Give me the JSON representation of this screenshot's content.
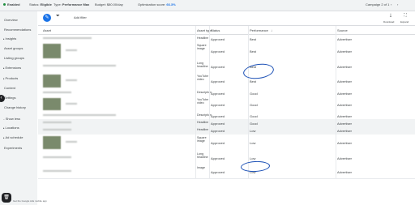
{
  "topbar": {
    "enabled": "Enabled",
    "status_label": "Status:",
    "status_value": "Eligible",
    "type_label": "Type:",
    "type_value": "Performance Max",
    "budget": "Budget: $80.00/day",
    "optimization_label": "Optimization score:",
    "optimization_value": "66.3%",
    "campaign_pager": "Campaign 2 of 1"
  },
  "sidebar": {
    "items": [
      {
        "label": "Overview",
        "arrow": ""
      },
      {
        "label": "Recommendations",
        "arrow": ""
      },
      {
        "label": "Insights",
        "arrow": "▸"
      },
      {
        "label": "Asset groups",
        "arrow": ""
      },
      {
        "label": "Listing groups",
        "arrow": ""
      },
      {
        "label": "Extensions",
        "arrow": "▸"
      },
      {
        "label": "Products",
        "arrow": "▸"
      },
      {
        "label": "Content",
        "arrow": ""
      },
      {
        "label": "Settings",
        "arrow": ""
      },
      {
        "label": "Change history",
        "arrow": ""
      },
      {
        "label": "Show less",
        "arrow": "−"
      },
      {
        "label": "Locations",
        "arrow": "▸"
      },
      {
        "label": "Ad schedule",
        "arrow": "▸"
      },
      {
        "label": "Experiments",
        "arrow": ""
      }
    ],
    "bottom_label": "Get the Google Ads mobile app"
  },
  "toolbar": {
    "add_filter": "Add filter",
    "download_label": "Download",
    "expand_label": "Expand"
  },
  "table": {
    "headers": {
      "asset": "Asset",
      "asset_type": "Asset type",
      "status": "Status",
      "performance": "Performance",
      "source": "Source"
    },
    "rows": [
      {
        "type": "Headline",
        "status": "Approved",
        "performance": "Best",
        "source": "Advertiser"
      },
      {
        "type": "Square image",
        "status": "Approved",
        "performance": "Best",
        "source": "Advertiser"
      },
      {
        "type": "Long headline",
        "status": "Approved",
        "performance": "Best",
        "source": "Advertiser"
      },
      {
        "type": "YouTube video",
        "status": "Approved",
        "performance": "Best",
        "source": "Advertiser"
      },
      {
        "type": "Description",
        "status": "Approved",
        "performance": "Good",
        "source": "Advertiser"
      },
      {
        "type": "YouTube video",
        "status": "Approved",
        "performance": "Good",
        "source": "Advertiser"
      },
      {
        "type": "Description",
        "status": "Approved",
        "performance": "Good",
        "source": "Advertiser"
      },
      {
        "type": "Headline",
        "status": "Approved",
        "performance": "Good",
        "source": "Advertiser"
      },
      {
        "type": "Headline",
        "status": "Approved",
        "performance": "Low",
        "source": "Advertiser"
      },
      {
        "type": "Square image",
        "status": "Approved",
        "performance": "Low",
        "source": "Advertiser"
      },
      {
        "type": "Long headline",
        "status": "Approved",
        "performance": "Low",
        "source": "Advertiser"
      },
      {
        "type": "Image",
        "status": "Approved",
        "performance": "Low",
        "source": "Advertiser"
      }
    ]
  },
  "colors": {
    "accent": "#1a73e8",
    "annotation": "#1a4fb5",
    "enabled": "#1e8e3e"
  }
}
